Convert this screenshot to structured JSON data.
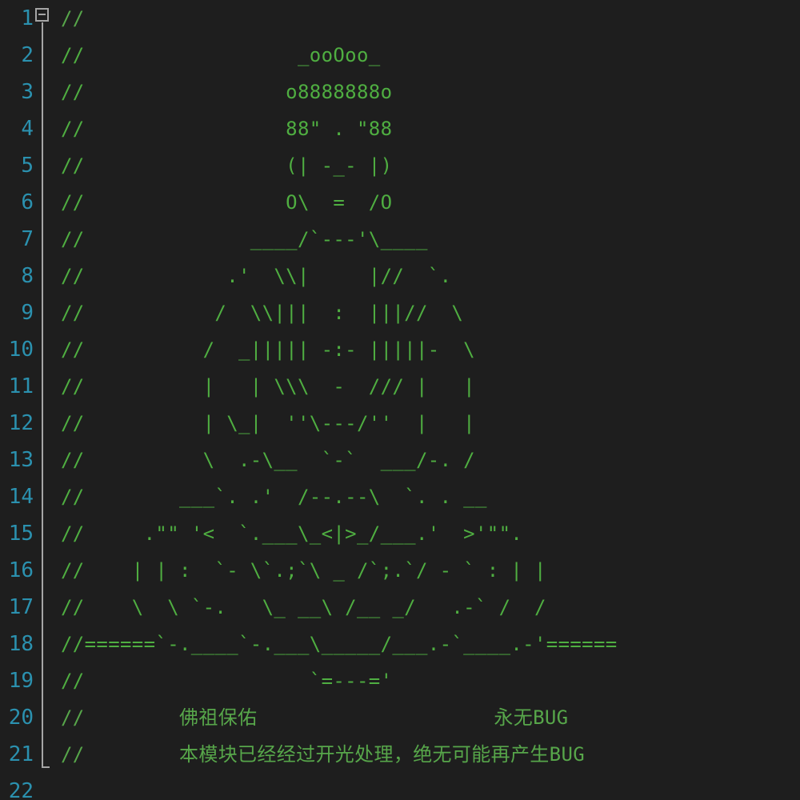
{
  "editor": {
    "line_numbers": [
      "1",
      "2",
      "3",
      "4",
      "5",
      "6",
      "7",
      "8",
      "9",
      "10",
      "11",
      "12",
      "13",
      "14",
      "15",
      "16",
      "17",
      "18",
      "19",
      "20",
      "21",
      "22"
    ],
    "lines": [
      "//",
      "//                  _ooOoo_",
      "//                 o8888888o",
      "//                 88\" . \"88",
      "//                 (| -_- |)",
      "//                 O\\  =  /O",
      "//              ____/`---'\\____",
      "//            .'  \\\\|     |//  `.",
      "//           /  \\\\|||  :  |||//  \\",
      "//          /  _||||| -:- |||||-  \\",
      "//          |   | \\\\\\  -  /// |   |",
      "//          | \\_|  ''\\---/''  |   |",
      "//          \\  .-\\__  `-`  ___/-. /",
      "//        ___`. .'  /--.--\\  `. . __",
      "//     .\"\" '<  `.___\\_<|>_/___.'  >'\"\".",
      "//    | | :  `- \\`.;`\\ _ /`;.`/ - ` : | |",
      "//    \\  \\ `-.   \\_ __\\ /__ _/   .-` /  /",
      "//======`-.____`-.___\\_____/___.-`____.-'======",
      "//                   `=---='",
      "//        佛祖保佑                    永无BUG",
      "//        本模块已经经过开光处理，绝无可能再产生BUG",
      ""
    ]
  }
}
